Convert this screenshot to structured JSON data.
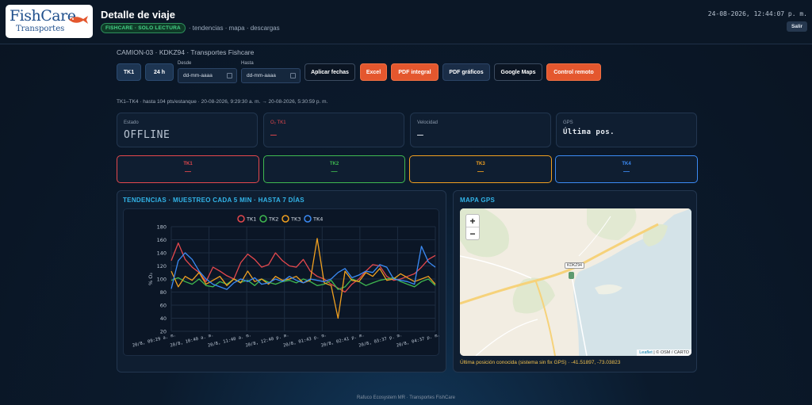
{
  "header": {
    "logo_line1": "FishCare",
    "logo_line2": "Transportes",
    "title": "Detalle de viaje",
    "badge": "FISHCARE · SOLO LECTURA",
    "nav_text": "· tendencias · mapa · descargas",
    "datetime": "24-08-2026, 12:44:07 p. m.",
    "logout_label": "Salir"
  },
  "vehicle_line": "CAMION-03 · KDKZ94 · Transportes Fishcare",
  "toolbar": {
    "tank_select": "TK1",
    "period": "24 h",
    "from_label": "Desde",
    "to_label": "Hasta",
    "from_placeholder": "dd-mm-aaaa",
    "to_placeholder": "dd-mm-aaaa",
    "apply_label": "Aplicar fechas",
    "excel_label": "Excel",
    "pdf_full_label": "PDF integral",
    "pdf_charts_label": "PDF gráficos",
    "gmaps_label": "Google Maps",
    "remote_label": "Control remoto"
  },
  "range_text": "TK1–TK4 · hasta 104 pts/estanque · 20-08-2026, 9:29:30 a. m. → 20-08-2026, 5:30:59 p. m.",
  "status_cards": [
    {
      "label": "Estado",
      "value": "OFFLINE"
    },
    {
      "label": "O₂ TK1",
      "value": "—"
    },
    {
      "label": "Velocidad",
      "value": "—"
    },
    {
      "label": "GPS",
      "value": "Última pos."
    }
  ],
  "tanks": [
    {
      "label": "TK1",
      "value": "—",
      "color": "#e5484d"
    },
    {
      "label": "TK2",
      "value": "—",
      "color": "#3fb950"
    },
    {
      "label": "TK3",
      "value": "—",
      "color": "#f0a020"
    },
    {
      "label": "TK4",
      "value": "—",
      "color": "#3b8bf5"
    }
  ],
  "trends_title": "TENDENCIAS · MUESTREO CADA 5 MIN · HASTA 7 DÍAS",
  "map_title": "MAPA GPS",
  "map": {
    "zoom_in": "+",
    "zoom_out": "−",
    "marker_label": "KDKZ94",
    "attribution_link": "Leaflet",
    "attribution_rest": " | © OSM / CARTO"
  },
  "last_position": "Última posición conocida (sistema sin fix GPS) · -41.51897, -73.03823",
  "footer": "Rafuco Ecosystem MR · Transportes FishCare",
  "chart_data": {
    "type": "line",
    "ylabel": "% O₂",
    "ylim": [
      20,
      180
    ],
    "yticks": [
      20,
      40,
      60,
      80,
      100,
      120,
      140,
      160,
      180
    ],
    "x": [
      "20/8, 09:29 a. m.",
      "20/8, 10:40 a. m.",
      "20/8, 11:40 a. m.",
      "20/8, 12:40 p. m.",
      "20/8, 01:43 p. m.",
      "20/8, 02:41 p. m.",
      "20/8, 03:37 p. m.",
      "20/8, 04:37 p. m."
    ],
    "legend_position": "top",
    "grid": true,
    "series": [
      {
        "name": "TK1",
        "color": "#e5484d",
        "values": [
          128,
          155,
          130,
          118,
          110,
          96,
          118,
          112,
          105,
          100,
          125,
          138,
          130,
          118,
          122,
          140,
          128,
          120,
          118,
          130,
          112,
          104,
          100,
          92,
          86,
          80,
          92,
          100,
          112,
          122,
          120,
          104,
          98,
          100,
          104,
          108,
          118,
          130,
          136
        ]
      },
      {
        "name": "TK2",
        "color": "#3fb950",
        "values": [
          98,
          102,
          96,
          92,
          100,
          90,
          88,
          96,
          92,
          100,
          95,
          98,
          90,
          100,
          95,
          92,
          96,
          98,
          94,
          100,
          96,
          90,
          92,
          98,
          84,
          88,
          100,
          96,
          90,
          94,
          98,
          100,
          102,
          96,
          92,
          88,
          96,
          100,
          90
        ]
      },
      {
        "name": "TK3",
        "color": "#f0a020",
        "values": [
          112,
          88,
          104,
          98,
          110,
          92,
          98,
          104,
          90,
          100,
          94,
          112,
          96,
          100,
          92,
          104,
          98,
          100,
          104,
          94,
          98,
          162,
          94,
          90,
          40,
          112,
          98,
          96,
          110,
          104,
          116,
          98,
          100,
          108,
          102,
          96,
          100,
          104,
          92
        ]
      },
      {
        "name": "TK4",
        "color": "#3b8bf5",
        "values": [
          85,
          128,
          140,
          130,
          112,
          100,
          92,
          88,
          84,
          94,
          100,
          96,
          102,
          92,
          94,
          100,
          96,
          104,
          98,
          94,
          100,
          98,
          96,
          100,
          110,
          116,
          102,
          106,
          112,
          110,
          122,
          118,
          100,
          98,
          96,
          92,
          150,
          126,
          118
        ]
      }
    ]
  }
}
